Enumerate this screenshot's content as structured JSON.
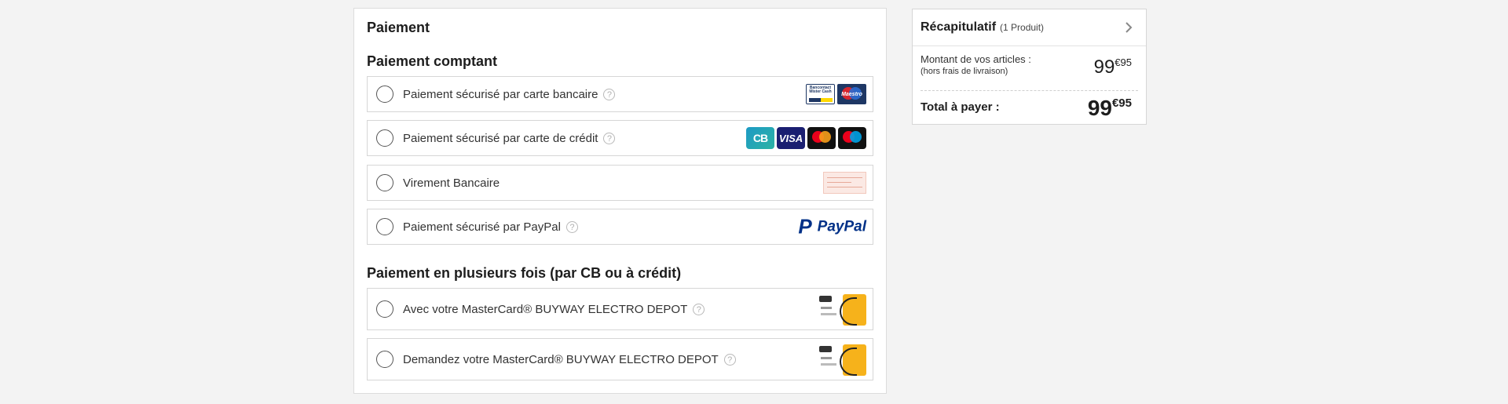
{
  "payment": {
    "title": "Paiement",
    "cash_section": "Paiement comptant",
    "cash_options": [
      {
        "label": "Paiement sécurisé par carte bancaire",
        "help": "?"
      },
      {
        "label": "Paiement sécurisé par carte de crédit",
        "help": "?"
      },
      {
        "label": "Virement Bancaire"
      },
      {
        "label": "Paiement sécurisé par PayPal",
        "help": "?"
      }
    ],
    "installment_section": "Paiement en plusieurs fois (par CB ou à crédit)",
    "installment_options": [
      {
        "label": "Avec votre MasterCard® BUYWAY ELECTRO DEPOT",
        "help": "?"
      },
      {
        "label": "Demandez votre MasterCard® BUYWAY ELECTRO DEPOT",
        "help": "?"
      }
    ],
    "logos": {
      "bancontact": "Bancontact Mister Cash",
      "maestro": "Maestro",
      "cb": "CB",
      "visa": "VISA",
      "paypal": "PayPal"
    }
  },
  "summary": {
    "title": "Récapitulatif",
    "count": "(1 Produit)",
    "subtotal_label": "Montant de vos articles :",
    "subtotal_note": "(hors frais de livraison)",
    "subtotal_int": "99",
    "subtotal_dec": "€95",
    "total_label": "Total à payer :",
    "total_int": "99",
    "total_dec": "€95"
  },
  "colors": {
    "background": "#f3f3f3",
    "border": "#d6d6d6",
    "paypal_dark": "#003087",
    "paypal_light": "#0070e0",
    "card_orange": "#f6b21b"
  }
}
